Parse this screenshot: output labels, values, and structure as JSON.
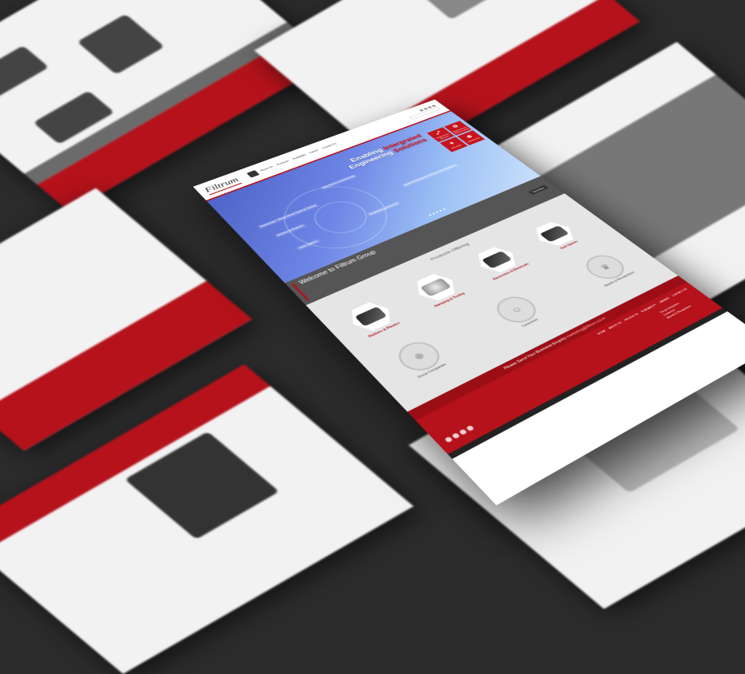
{
  "brand": {
    "logo_text": "Filtrum",
    "logo_tagline": "",
    "accent_color": "#b5121b",
    "dark_color": "#555555"
  },
  "header": {
    "nav": [
      "About Us",
      "Products",
      "Scalability",
      "Career",
      "Contact Us"
    ],
    "search_placeholder": ""
  },
  "hero": {
    "title_line1_white": "Enabling",
    "title_line1_red": "Intergrated",
    "title_line2_white": "Engineering",
    "title_line2_red": "Solutions",
    "labels": [
      "Stampings / Sheet Metal Parts & Tooling",
      "Rubber & Plastics",
      "Auto Spares",
      "Electronics & Electricals",
      "Rapid Prototyping / Product Development",
      "Engineering Services"
    ],
    "tiles": [
      {
        "icon": "expand-icon",
        "label": "Engineering Services"
      },
      {
        "icon": "gear-icon",
        "label": "Engineering & Manufacturing"
      },
      {
        "icon": "lightbulb-icon",
        "label": "Innovation"
      },
      {
        "icon": "group-icon",
        "label": "Collaborative"
      }
    ]
  },
  "welcome": {
    "title": "Welcome to Filtrum Group",
    "body": "",
    "read_more": "Read More"
  },
  "products": {
    "heading": "Products Offering",
    "items": [
      {
        "label": "Rubbers & Plastics"
      },
      {
        "label": "Stamping & Tooling"
      },
      {
        "label": "Electronics & Electricals"
      },
      {
        "label": "Auto Spares"
      }
    ],
    "extras": [
      {
        "icon": "trophy-icon",
        "label": "Awards & Recognitions"
      },
      {
        "icon": "people-icon",
        "label": "Customers"
      },
      {
        "icon": "network-icon",
        "label": "Group Companies"
      }
    ]
  },
  "enquiry": {
    "text": "Please Send Your Business Enquiry",
    "email": "marketing@filtrum.co.in"
  },
  "footer": {
    "nav": [
      "HOME",
      "ABOUT US",
      "PRODUCTS",
      "SCALABILITY",
      "CAREER",
      "CONTACT US"
    ],
    "address_title": "",
    "tel": "",
    "email": "",
    "links": [
      "Group Companies",
      "Customers",
      "Awards & Recognitions"
    ],
    "copyright": ""
  }
}
